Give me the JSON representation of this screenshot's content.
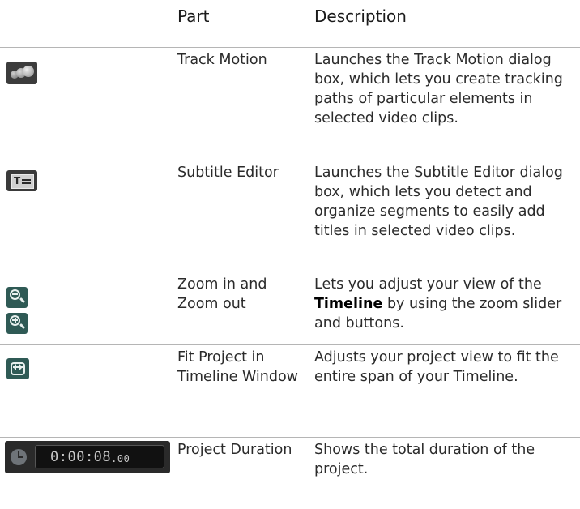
{
  "header": {
    "part": "Part",
    "description": "Description"
  },
  "rows": [
    {
      "part": "Track Motion",
      "description": "Launches the Track Motion dialog box, which lets you create tracking paths of particular elements in selected video clips.",
      "icon": "track-motion-icon"
    },
    {
      "part": "Subtitle Editor",
      "description": "Launches the Subtitle Editor dialog box, which lets you detect and organize segments to easily add titles in selected video clips.",
      "icon": "subtitle-editor-icon"
    },
    {
      "part": "Zoom in and Zoom out",
      "description_before": "Lets you adjust your view of the ",
      "description_bold": "Timeline",
      "description_after": " by using the zoom slider and buttons.",
      "icons": [
        "zoom-out-icon",
        "zoom-in-icon"
      ]
    },
    {
      "part": "Fit Project in Timeline Window",
      "description": "Adjusts your project view to fit the entire span of your Timeline.",
      "icon": "fit-project-icon"
    },
    {
      "part": "Project Duration",
      "description": "Shows the total duration of the project.",
      "icon": "clock-icon",
      "timecode": "0:00:08",
      "timecode_frames": ".00"
    }
  ],
  "colors": {
    "text": "#2b2b2b",
    "rule": "#b5b5b5",
    "icon_dark": "#3a3a3a",
    "icon_teal": "#2f5a55"
  }
}
